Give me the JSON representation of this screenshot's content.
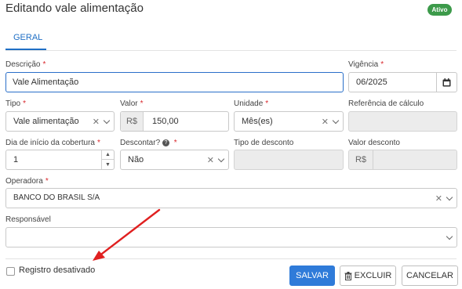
{
  "header": {
    "title": "Editando vale alimentação",
    "status_badge": "Ativo"
  },
  "tabs": [
    {
      "label": "GERAL"
    }
  ],
  "form": {
    "descricao": {
      "label": "Descrição",
      "required": "*",
      "value": "Vale Alimentação"
    },
    "vigencia": {
      "label": "Vigência",
      "required": "*",
      "value": "06/2025"
    },
    "tipo": {
      "label": "Tipo",
      "required": "*",
      "value": "Vale alimentação"
    },
    "valor": {
      "label": "Valor",
      "required": "*",
      "prefix": "R$",
      "value": "150,00"
    },
    "unidade": {
      "label": "Unidade",
      "required": "*",
      "value": "Mês(es)"
    },
    "referencia": {
      "label": "Referência de cálculo",
      "value": ""
    },
    "dia_inicio": {
      "label": "Dia de início da cobertura",
      "required": "*",
      "value": "1"
    },
    "descontar": {
      "label": "Descontar?",
      "required": "*",
      "value": "Não"
    },
    "tipo_desconto": {
      "label": "Tipo de desconto",
      "value": ""
    },
    "valor_desconto": {
      "label": "Valor desconto",
      "prefix": "R$",
      "value": ""
    },
    "operadora": {
      "label": "Operadora",
      "required": "*",
      "value": "BANCO DO BRASIL S/A"
    },
    "responsavel": {
      "label": "Responsável",
      "value": ""
    }
  },
  "footer": {
    "checkbox_label": "Registro desativado",
    "save_label": "SALVAR",
    "delete_label": "EXCLUIR",
    "cancel_label": "CANCELAR"
  },
  "colors": {
    "primary": "#2f7bd9",
    "badge": "#3c9a4a",
    "required": "#d9262b",
    "annotation_arrow": "#e02020"
  }
}
